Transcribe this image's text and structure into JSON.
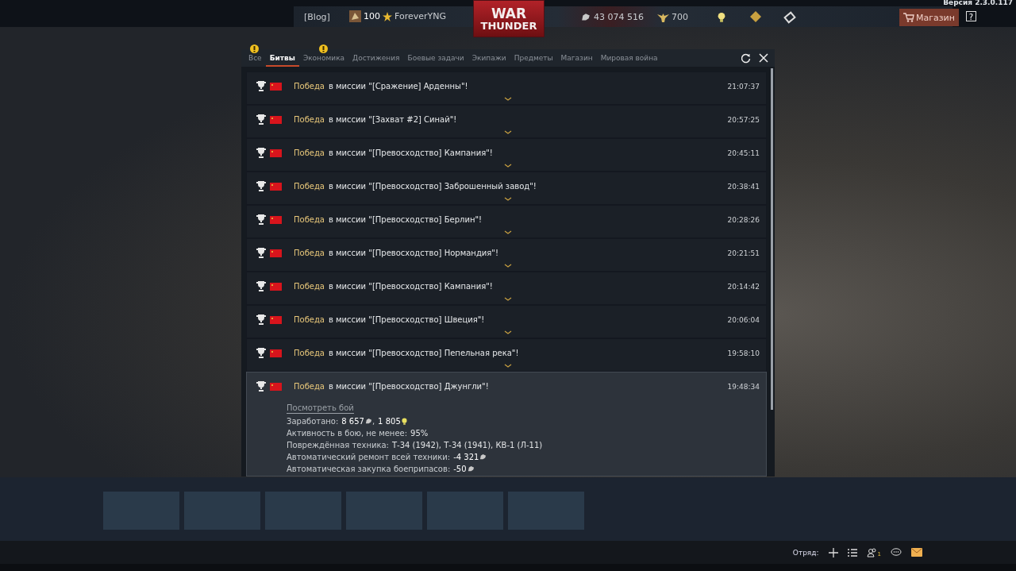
{
  "version": "Версия 2.3.0.117",
  "top_bar": {
    "blog": "[Blog]",
    "rank": "100",
    "player": "ForeverYNG",
    "logo_top": "WAR",
    "logo_bottom": "THUNDER",
    "silver_lions": "43 074 516",
    "golden_eagles": "700",
    "shop": "Магазин",
    "help": "?"
  },
  "tabs": [
    {
      "label": "Все",
      "selected": false,
      "alert": true
    },
    {
      "label": "Битвы",
      "selected": true,
      "alert": false
    },
    {
      "label": "Экономика",
      "selected": false,
      "alert": true
    },
    {
      "label": "Достижения",
      "selected": false,
      "alert": false
    },
    {
      "label": "Боевые задачи",
      "selected": false,
      "alert": false
    },
    {
      "label": "Экипажи",
      "selected": false,
      "alert": false
    },
    {
      "label": "Предметы",
      "selected": false,
      "alert": false
    },
    {
      "label": "Магазин",
      "selected": false,
      "alert": false
    },
    {
      "label": "Мировая война",
      "selected": false,
      "alert": false
    }
  ],
  "messages": [
    {
      "result": "Победа",
      "text": "в миссии \"[Сражение] Арденны\"!",
      "time": "21:07:37",
      "expanded": false
    },
    {
      "result": "Победа",
      "text": "в миссии \"[Захват #2] Синай\"!",
      "time": "20:57:25",
      "expanded": false
    },
    {
      "result": "Победа",
      "text": "в миссии \"[Превосходство] Кампания\"!",
      "time": "20:45:11",
      "expanded": false
    },
    {
      "result": "Победа",
      "text": "в миссии \"[Превосходство] Заброшенный завод\"!",
      "time": "20:38:41",
      "expanded": false
    },
    {
      "result": "Победа",
      "text": "в миссии \"[Превосходство] Берлин\"!",
      "time": "20:28:26",
      "expanded": false
    },
    {
      "result": "Победа",
      "text": "в миссии \"[Превосходство] Нормандия\"!",
      "time": "20:21:51",
      "expanded": false
    },
    {
      "result": "Победа",
      "text": "в миссии \"[Превосходство] Кампания\"!",
      "time": "20:14:42",
      "expanded": false
    },
    {
      "result": "Победа",
      "text": "в миссии \"[Превосходство] Швеция\"!",
      "time": "20:06:04",
      "expanded": false
    },
    {
      "result": "Победа",
      "text": "в миссии \"[Превосходство] Пепельная река\"!",
      "time": "19:58:10",
      "expanded": false
    },
    {
      "result": "Победа",
      "text": "в миссии \"[Превосходство] Джунгли\"!",
      "time": "19:48:34",
      "expanded": true,
      "link": "Посмотреть бой",
      "details": [
        {
          "label": "Заработано:",
          "values": [
            {
              "text": "8 657",
              "kind": "lions"
            },
            {
              "separator": ",",
              "text": "1 805",
              "kind": "research"
            }
          ]
        },
        {
          "label": "Активность в бою, не менее:",
          "values": [
            {
              "text": "95%",
              "kind": "plain"
            }
          ]
        },
        {
          "label": "Повреждённая техника:",
          "values": [
            {
              "text": "Т-34 (1942), Т-34 (1941), КВ-1 (Л-11)",
              "kind": "plain"
            }
          ]
        },
        {
          "label": "Автоматический ремонт всей техники:",
          "values": [
            {
              "text": "-4 321",
              "kind": "lions"
            }
          ]
        },
        {
          "label": "Автоматическая закупка боеприпасов:",
          "values": [
            {
              "text": "-50",
              "kind": "lions"
            }
          ]
        }
      ]
    }
  ],
  "bottom_bar": {
    "squad_label": "Отряд:",
    "squad_count": "1"
  }
}
